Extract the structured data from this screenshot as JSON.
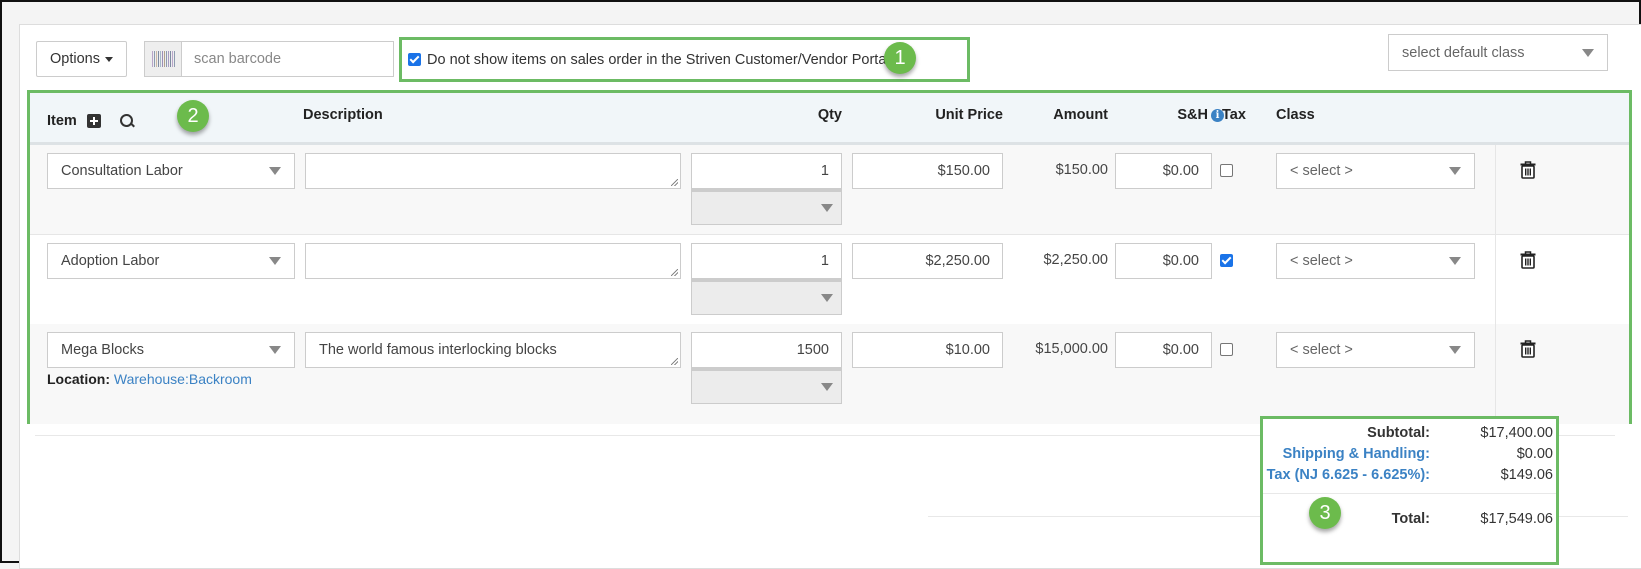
{
  "toolbar": {
    "options_label": "Options",
    "barcode_placeholder": "scan barcode",
    "portal_checkbox": {
      "checked": true,
      "label": "Do not show items on sales order in the Striven Customer/Vendor Portal"
    },
    "default_class_placeholder": "select default class"
  },
  "callouts": [
    "1",
    "2",
    "3"
  ],
  "table": {
    "headers": {
      "item": "Item",
      "description": "Description",
      "qty": "Qty",
      "unit_price": "Unit Price",
      "amount": "Amount",
      "sh": "S&H",
      "tax": "Tax",
      "class": "Class"
    },
    "rows": [
      {
        "item": "Consultation Labor",
        "description": "",
        "qty": "1",
        "unit_price": "$150.00",
        "amount": "$150.00",
        "sh": "$0.00",
        "tax": false,
        "class": "< select >",
        "location_label": null,
        "location": null
      },
      {
        "item": "Adoption Labor",
        "description": "",
        "qty": "1",
        "unit_price": "$2,250.00",
        "amount": "$2,250.00",
        "sh": "$0.00",
        "tax": true,
        "class": "< select >",
        "location_label": null,
        "location": null
      },
      {
        "item": "Mega Blocks",
        "description": "The world famous interlocking blocks",
        "qty": "1500",
        "unit_price": "$10.00",
        "amount": "$15,000.00",
        "sh": "$0.00",
        "tax": false,
        "class": "< select >",
        "location_label": "Location:",
        "location": "Warehouse:Backroom"
      }
    ]
  },
  "totals": {
    "subtotal_label": "Subtotal:",
    "subtotal": "$17,400.00",
    "shipping_label": "Shipping & Handling:",
    "shipping": "$0.00",
    "tax_label": "Tax (NJ 6.625 - 6.625%):",
    "tax": "$149.06",
    "total_label": "Total:",
    "total": "$17,549.06"
  },
  "colors": {
    "highlight": "#6cbb64",
    "callout": "#6cbb4c",
    "link": "#3b82c4",
    "checkbox": "#1a73e8"
  }
}
